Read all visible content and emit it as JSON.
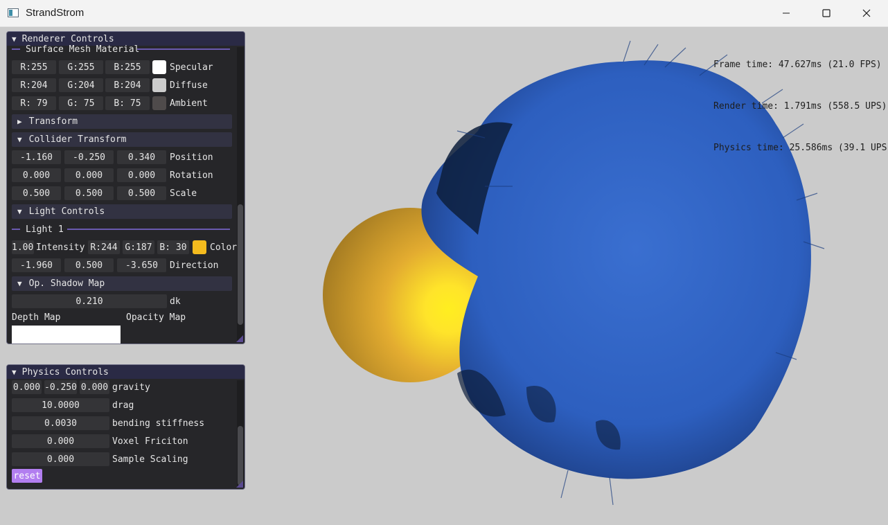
{
  "window": {
    "title": "StrandStrom"
  },
  "stats": {
    "frame": "Frame time: 47.627ms (21.0 FPS)",
    "render": "Render time: 1.791ms (558.5 UPS)",
    "physics": "Physics time: 25.586ms (39.1 UPS)"
  },
  "renderer": {
    "title": "Renderer Controls",
    "surface_title": "Surface Mesh Material",
    "materials": [
      {
        "r": "R:255",
        "g": "G:255",
        "b": "B:255",
        "label": "Specular",
        "color": "#ffffff"
      },
      {
        "r": "R:204",
        "g": "G:204",
        "b": "B:204",
        "label": "Diffuse",
        "color": "#cccccc"
      },
      {
        "r": "R: 79",
        "g": "G: 75",
        "b": "B: 75",
        "label": "Ambient",
        "color": "#4f4b4b"
      }
    ],
    "transform_header": "Transform",
    "collider_header": "Collider Transform",
    "collider": [
      {
        "a": "-1.160",
        "b": "-0.250",
        "c": "0.340",
        "label": "Position"
      },
      {
        "a": "0.000",
        "b": "0.000",
        "c": "0.000",
        "label": "Rotation"
      },
      {
        "a": "0.500",
        "b": "0.500",
        "c": "0.500",
        "label": "Scale"
      }
    ],
    "light_header": "Light Controls",
    "light1_title": "Light 1",
    "light": {
      "intensity_value": "1.00",
      "intensity_label": "Intensity",
      "r": "R:244",
      "g": "G:187",
      "b": "B: 30",
      "color_label": "Color",
      "color": "#f4bb1e",
      "dir_a": "-1.960",
      "dir_b": "0.500",
      "dir_c": "-3.650",
      "dir_label": "Direction"
    },
    "shadow_header": "Op. Shadow Map",
    "dk_value": "0.210",
    "dk_label": "dk",
    "depth_map_label": "Depth Map",
    "opacity_map_label": "Opacity Map"
  },
  "physics": {
    "title": "Physics Controls",
    "gravity": {
      "x": "0.000",
      "y": "-0.250",
      "z": "0.000",
      "label": "gravity"
    },
    "drag": {
      "value": "10.0000",
      "label": "drag"
    },
    "bending": {
      "value": "0.0030",
      "label": "bending stiffness"
    },
    "voxel": {
      "value": "0.000",
      "label": "Voxel Friciton"
    },
    "sample": {
      "value": "0.000",
      "label": "Sample Scaling"
    },
    "reset_label": "reset"
  },
  "scene": {
    "hair_color": "#2f63c4",
    "sphere_color": "#f2b531"
  }
}
